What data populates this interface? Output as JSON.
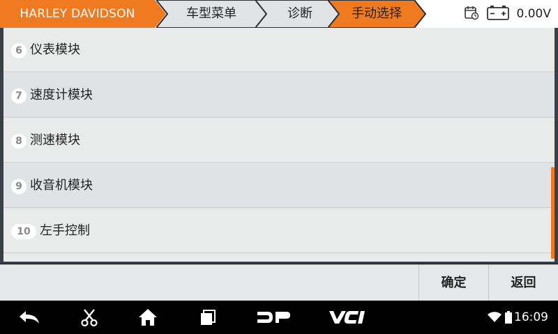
{
  "breadcrumb": {
    "items": [
      {
        "label": "HARLEY DAVIDSON"
      },
      {
        "label": "车型菜单"
      },
      {
        "label": "诊断"
      },
      {
        "label": "手动选择"
      }
    ]
  },
  "status": {
    "voltage": "0.00V"
  },
  "list": {
    "items": [
      {
        "num": "6",
        "label": "仪表模块"
      },
      {
        "num": "7",
        "label": "速度计模块"
      },
      {
        "num": "8",
        "label": "测速模块"
      },
      {
        "num": "9",
        "label": "收音机模块"
      },
      {
        "num": "10",
        "label": "左手控制"
      }
    ]
  },
  "actions": {
    "confirm": "确定",
    "back": "返回"
  },
  "navbar": {
    "clock": "16:09"
  },
  "colors": {
    "accent_orange": "#f07a20",
    "crumb_gray": "#e2e3e4",
    "list_bg": "#e9eaea",
    "list_alt_bg": "#dfe3e5"
  }
}
